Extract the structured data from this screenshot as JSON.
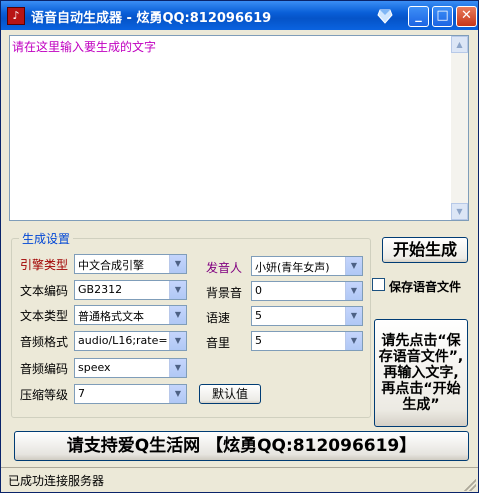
{
  "window": {
    "title": "语音自动生成器 - 炫勇QQ:812096619",
    "icon": "app-music-icon",
    "controls": [
      "minimize-icon",
      "maximize-icon",
      "close-icon"
    ]
  },
  "input_area": {
    "value": "请在这里输入要生成的文字"
  },
  "settings": {
    "group_title": "生成设置",
    "engine_label": "引擎类型",
    "engine_value": "中文合成引擎",
    "text_encoding_label": "文本编码",
    "text_encoding_value": "GB2312",
    "text_type_label": "文本类型",
    "text_type_value": "普通格式文本",
    "audio_format_label": "音频格式",
    "audio_format_value": "audio/L16;rate=",
    "audio_codec_label": "音频编码",
    "audio_codec_value": "speex",
    "compression_label": "压缩等级",
    "compression_value": "7",
    "speaker_label": "发音人",
    "speaker_value": "小妍(青年女声)",
    "bg_sound_label": "背景音",
    "bg_sound_value": "0",
    "speed_label": "语速",
    "speed_value": "5",
    "volume_label": "音里",
    "volume_value": "5",
    "default_button": "默认值"
  },
  "actions": {
    "start_button": "开始生成",
    "save_checkbox_label": "保存语音文件",
    "save_checked": false,
    "instruction_button": "请先点击“保存语音文件”,再输入文字,再点击“开始生成”"
  },
  "banner": "请支持爱Q生活网 【炫勇QQ:812096619】",
  "status": "已成功连接服务器",
  "colors": {
    "title_bar": "#0a5fd8",
    "input_text": "#c000c0",
    "group_title": "#0046d5",
    "red_label": "#a00000",
    "purple_label": "#800080"
  }
}
